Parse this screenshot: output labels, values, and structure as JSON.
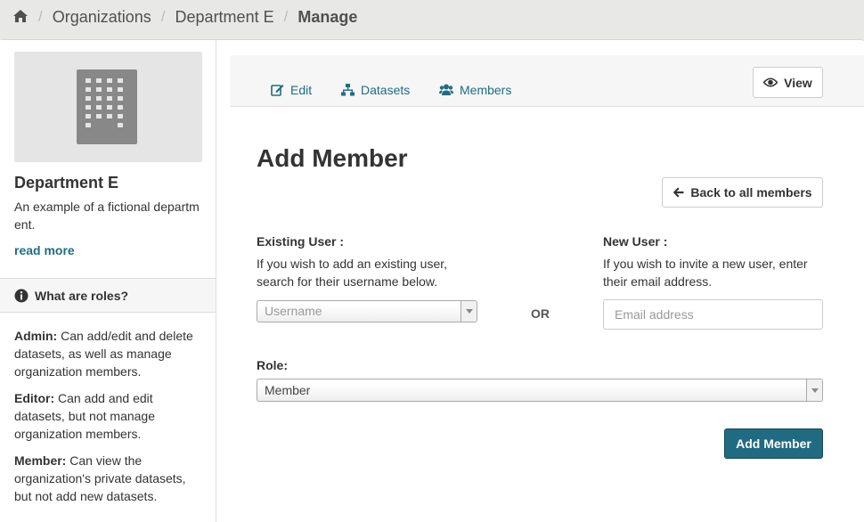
{
  "breadcrumb": {
    "items": [
      "Organizations",
      "Department E"
    ],
    "current": "Manage"
  },
  "sidebar": {
    "org_name": "Department E",
    "org_description": "An example of a fictional department.",
    "read_more": "read more",
    "roles_header": "What are roles?",
    "roles": [
      {
        "name": "Admin:",
        "description": "Can add/edit and delete datasets, as well as manage organization members."
      },
      {
        "name": "Editor:",
        "description": "Can add and edit datasets, but not manage organization members."
      },
      {
        "name": "Member:",
        "description": "Can view the organization's private datasets, but not add new datasets."
      }
    ]
  },
  "tabs": {
    "edit": "Edit",
    "datasets": "Datasets",
    "members": "Members",
    "view": "View"
  },
  "form": {
    "title": "Add Member",
    "back_button": "Back to all members",
    "existing_user_label": "Existing User :",
    "existing_user_help_1": "If you wish to add an existing user,",
    "existing_user_help_2": "search for their username below.",
    "username_placeholder": "Username",
    "or_label": "OR",
    "new_user_label": "New User :",
    "new_user_help_1": "If you wish to invite a new user, enter",
    "new_user_help_2": "their email address.",
    "email_placeholder": "Email address",
    "role_label": "Role:",
    "role_value": "Member",
    "submit_button": "Add Member"
  },
  "colors": {
    "link": "#1f6d83",
    "primary_button": "#206b82"
  }
}
